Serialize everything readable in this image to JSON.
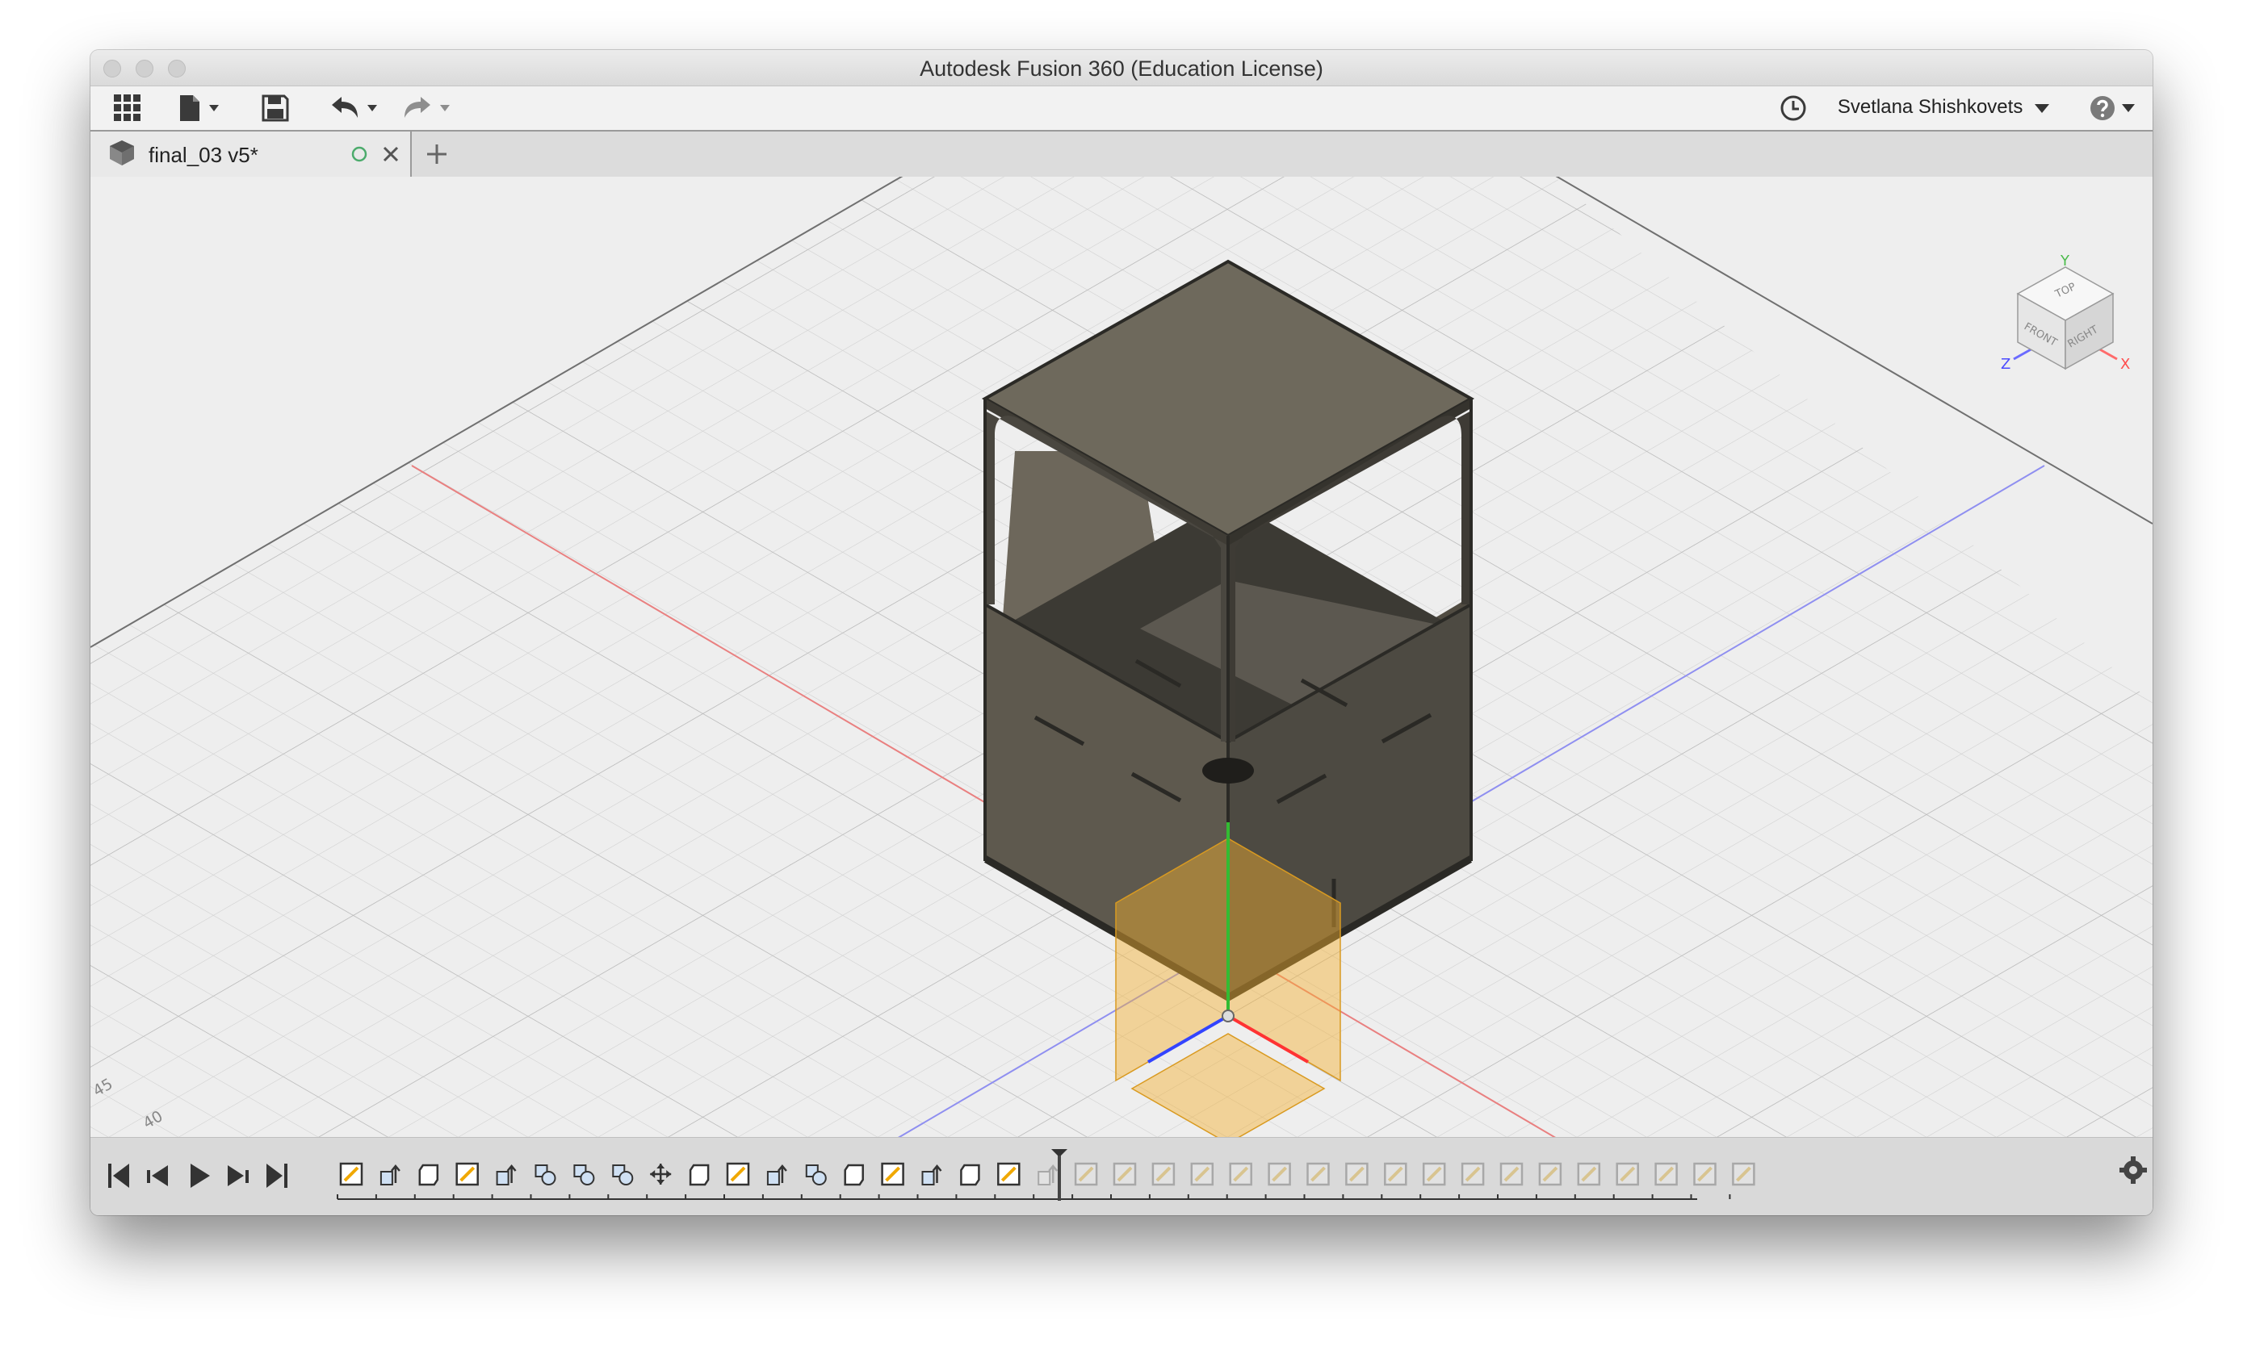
{
  "window": {
    "title": "Autodesk Fusion 360 (Education License)"
  },
  "toolbar": {
    "user_name": "Svetlana Shishkovets",
    "icons": [
      "grid-icon",
      "file-icon",
      "save-icon",
      "undo-icon",
      "redo-icon",
      "clock-icon",
      "help-icon"
    ]
  },
  "tabs": [
    {
      "label": "final_03 v5*"
    }
  ],
  "viewcube": {
    "faces": {
      "top": "TOP",
      "front": "FRONT",
      "right": "RIGHT"
    },
    "axes": {
      "x": "X",
      "y": "Y",
      "z": "Z"
    }
  },
  "ruler": {
    "labels": [
      "45",
      "40"
    ]
  },
  "timeline": {
    "playback": [
      "skip-to-start",
      "step-back",
      "play",
      "step-forward",
      "skip-to-end"
    ],
    "features": [
      "sketch",
      "extrude",
      "body",
      "sketch",
      "extrude",
      "combine",
      "combine",
      "combine",
      "move",
      "body",
      "sketch",
      "extrude",
      "combine",
      "body",
      "sketch",
      "extrude",
      "body",
      "sketch",
      "extrude",
      "sketch",
      "sketch",
      "sketch",
      "sketch",
      "sketch",
      "sketch",
      "sketch",
      "sketch",
      "sketch",
      "sketch",
      "sketch",
      "sketch",
      "sketch",
      "sketch",
      "sketch",
      "sketch",
      "sketch",
      "sketch"
    ],
    "active_count": 18
  },
  "colors": {
    "accent_x": "#ff3333",
    "accent_y": "#33bb33",
    "accent_z": "#3344ff",
    "body": "#6b6558",
    "selection": "#f4b02f"
  }
}
